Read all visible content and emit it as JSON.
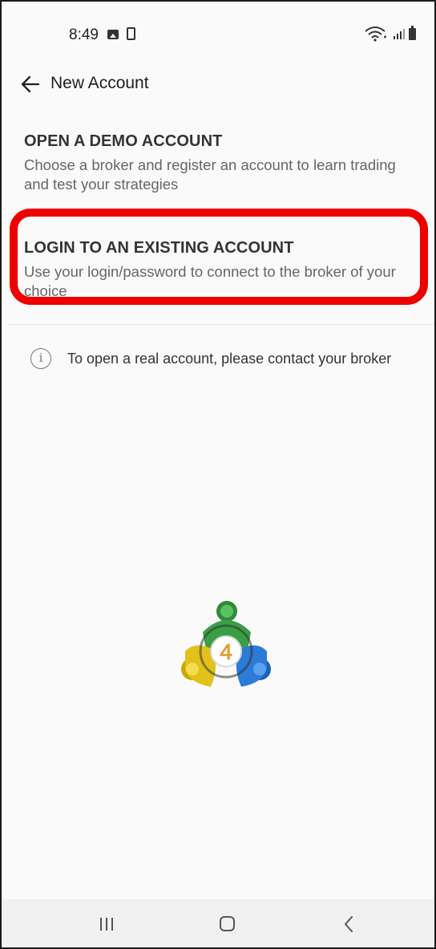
{
  "status_bar": {
    "time": "8:49"
  },
  "app_bar": {
    "title": "New Account"
  },
  "options": [
    {
      "title": "OPEN A DEMO ACCOUNT",
      "description": "Choose a broker and register an account to learn trading and test your strategies"
    },
    {
      "title": "LOGIN TO AN EXISTING ACCOUNT",
      "description": "Use your login/password to connect to the broker of your choice"
    }
  ],
  "info": {
    "text": "To open a real account, please contact your broker"
  },
  "colors": {
    "highlight": "#ee0000",
    "title_text": "#333333",
    "description_text": "#666666"
  },
  "icons": {
    "back": "arrow-left-icon",
    "info": "info-icon",
    "logo": "metatrader-4-logo"
  }
}
